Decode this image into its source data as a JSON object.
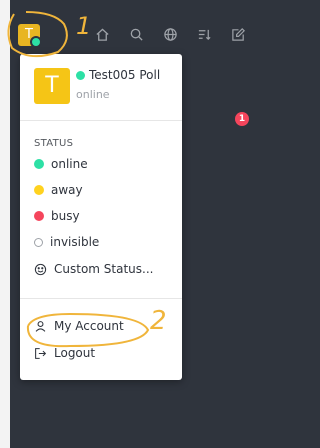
{
  "topbar": {
    "avatar_letter": "T",
    "icons": [
      "home-icon",
      "search-icon",
      "directory-icon",
      "sort-icon",
      "create-new-icon"
    ],
    "notification_count": "1"
  },
  "menu": {
    "user": {
      "avatar_letter": "T",
      "name": "Test005 Poll",
      "status": "online"
    },
    "status_title": "STATUS",
    "statuses": [
      {
        "label": "online",
        "color": "#2de0a5"
      },
      {
        "label": "away",
        "color": "#ffd21f"
      },
      {
        "label": "busy",
        "color": "#f5455c"
      },
      {
        "label": "invisible",
        "color": "#cbced1"
      }
    ],
    "custom_status": "Custom Status...",
    "my_account": "My Account",
    "logout": "Logout"
  },
  "annotations": {
    "marker_1": "1",
    "marker_2": "2",
    "ink_color": "#f0b53b"
  }
}
